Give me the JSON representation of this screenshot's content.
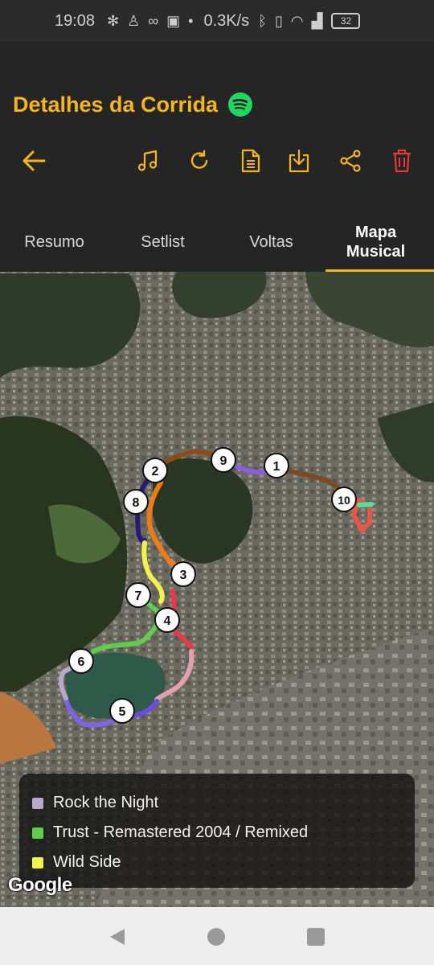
{
  "status_bar": {
    "time": "19:08",
    "network_speed": "0.3K/s",
    "battery": "32",
    "icons": [
      "fan-icon",
      "person-icon",
      "voicemail-icon",
      "screen-icon",
      "dot-icon",
      "bluetooth-icon",
      "vibrate-icon",
      "wifi-icon",
      "signal-icon",
      "battery-icon"
    ]
  },
  "header": {
    "title": "Detalhes da Corrida",
    "accent_color": "#f5b61c",
    "delete_color": "#e53935",
    "spotify_color": "#1ed760"
  },
  "toolbar": {
    "icons": [
      "back-arrow-icon",
      "music-note-icon",
      "refresh-icon",
      "document-icon",
      "download-icon",
      "share-icon",
      "trash-icon"
    ]
  },
  "tabs": [
    {
      "label": "Resumo",
      "active": false
    },
    {
      "label": "Setlist",
      "active": false
    },
    {
      "label": "Voltas",
      "active": false
    },
    {
      "label": "Mapa Musical",
      "active": true
    }
  ],
  "map": {
    "markers": [
      "1",
      "2",
      "3",
      "4",
      "5",
      "6",
      "7",
      "8",
      "9",
      "10"
    ],
    "attribution": "Google"
  },
  "legend": [
    {
      "label": "Rock the Night",
      "color": "#b7a9cc"
    },
    {
      "label": "Trust - Remastered 2004 / Remixed",
      "color": "#5fce4a"
    },
    {
      "label": "Wild Side",
      "color": "#f2f24a"
    }
  ],
  "nav_bar": {
    "icons": [
      "back-triangle-icon",
      "home-circle-icon",
      "recents-square-icon"
    ]
  }
}
